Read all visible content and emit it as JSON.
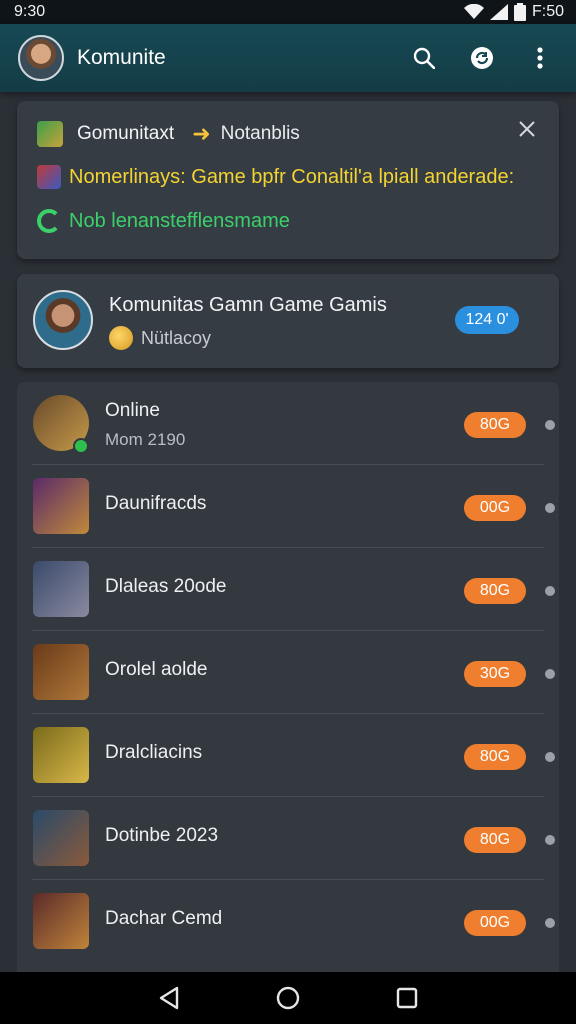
{
  "status_bar": {
    "time": "9:30",
    "right_time": "F:50"
  },
  "app_bar": {
    "title": "Komunite"
  },
  "notification": {
    "title": "Gomunitaxt",
    "title2": "Notanblis",
    "line_yellow": "Nomerlinays: Game bpfr Conaltil'a lpiall anderade:",
    "line_green": "Nob lenanstefflensmame"
  },
  "profile": {
    "name": "Komunitas Gamn Game Gamis",
    "subtitle": "Nütlacoy",
    "badge": "124 0'"
  },
  "games": [
    {
      "title": "Online",
      "subtitle": "Mom 2190",
      "badge": "80G",
      "colors": [
        "#6a4a2a",
        "#c59a4a"
      ]
    },
    {
      "title": "Daunifracds",
      "subtitle": "",
      "badge": "00G",
      "colors": [
        "#5a2a6a",
        "#c08a3a"
      ]
    },
    {
      "title": "Dlaleas 20ode",
      "subtitle": "",
      "badge": "80G",
      "colors": [
        "#3a4a6a",
        "#8a8aa0"
      ]
    },
    {
      "title": "Orolel aolde",
      "subtitle": "",
      "badge": "30G",
      "colors": [
        "#6a3a1a",
        "#b0783a"
      ]
    },
    {
      "title": "Dralcliacins",
      "subtitle": "",
      "badge": "80G",
      "colors": [
        "#7a6a1a",
        "#d9b84a"
      ]
    },
    {
      "title": "Dotinbe 2023",
      "subtitle": "",
      "badge": "80G",
      "colors": [
        "#2a4a6a",
        "#8a5a3a"
      ]
    },
    {
      "title": "Dachar Cemd",
      "subtitle": "",
      "badge": "00G",
      "colors": [
        "#5a2a2a",
        "#c0843a"
      ]
    }
  ],
  "icons": {
    "search": "search-icon",
    "sync": "sync-icon",
    "more": "more-vert-icon",
    "close": "close-icon"
  },
  "colors": {
    "accent_orange": "#ef7f2f",
    "accent_blue": "#2b8fe0",
    "appbar": "#174954"
  }
}
